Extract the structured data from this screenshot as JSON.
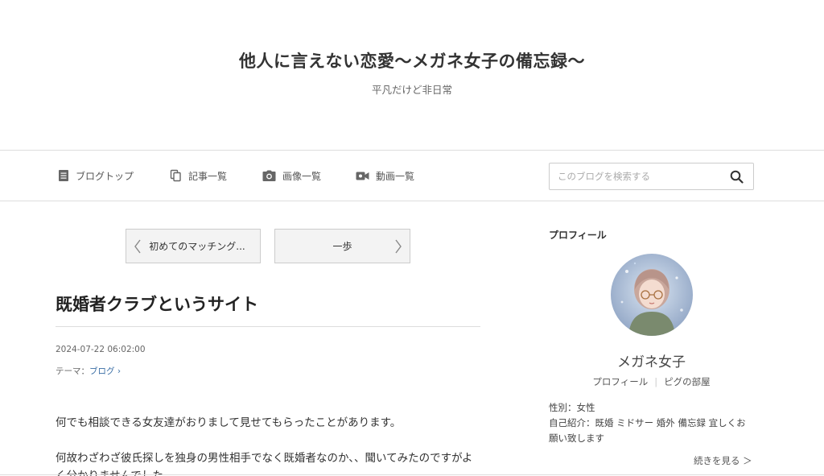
{
  "header": {
    "title": "他人に言えない恋愛〜メガネ女子の備忘録〜",
    "subtitle": "平凡だけど非日常"
  },
  "nav": {
    "items": [
      {
        "label": "ブログトップ",
        "icon": "document-icon"
      },
      {
        "label": "記事一覧",
        "icon": "copy-icon"
      },
      {
        "label": "画像一覧",
        "icon": "camera-icon"
      },
      {
        "label": "動画一覧",
        "icon": "video-icon"
      }
    ],
    "search_placeholder": "このブログを検索する",
    "search_value": ""
  },
  "pager": {
    "prev_label": "初めてのマッチング...",
    "next_label": "一歩"
  },
  "article": {
    "title": "既婚者クラブというサイト",
    "date": "2024-07-22 06:02:00",
    "theme_label": "テーマ：",
    "theme_value": "ブログ",
    "paragraphs": [
      "何でも相談できる女友達がおりまして見せてもらったことがあります。",
      "何故わざわざ彼氏探しを独身の男性相手でなく既婚者なのか、、聞いてみたのですがよく分かりませんでした"
    ]
  },
  "sidebar": {
    "heading": "プロフィール",
    "name": "メガネ女子",
    "link_profile": "プロフィール",
    "link_room": "ピグの部屋",
    "gender": "性別：女性",
    "intro": "自己紹介：既婚 ミドサー 婚外 備忘録 宜しくお願い致します",
    "more": "続きを見る"
  },
  "colors": {
    "text": "#333333",
    "link": "#3a6ea5",
    "border": "#dddddd",
    "button_bg": "#f3f3f3"
  }
}
